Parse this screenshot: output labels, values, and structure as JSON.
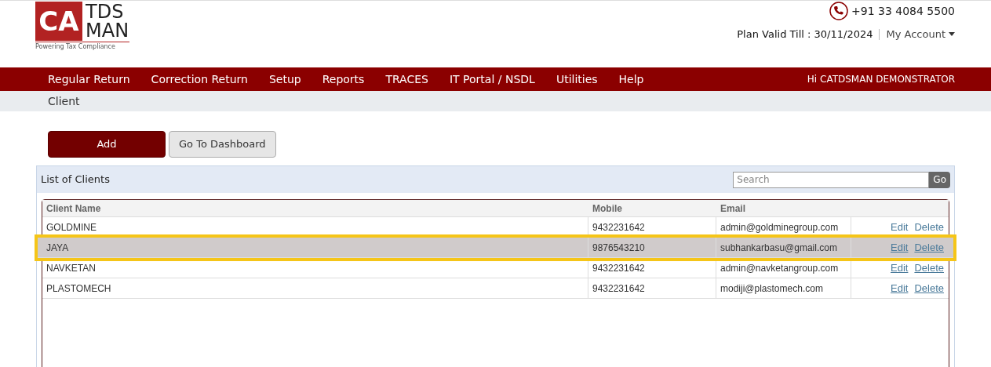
{
  "logo": {
    "mark": "CA",
    "line_1": "TDS",
    "line_2": "MAN",
    "tagline": "Powering Tax Compliance"
  },
  "phone": "+91 33 4084 5500",
  "plan_valid": "Plan Valid Till : 30/11/2024",
  "account_menu": "My Account",
  "nav": [
    "Regular Return",
    "Correction Return",
    "Setup",
    "Reports",
    "TRACES",
    "IT Portal / NSDL",
    "Utilities",
    "Help"
  ],
  "greeting": "Hi CATDSMAN DEMONSTRATOR",
  "breadcrumb": "Client",
  "buttons": [
    {
      "label": "Add",
      "kind": "primary"
    },
    {
      "label": "Go To Dashboard",
      "kind": "secondary"
    }
  ],
  "panel": {
    "title": "List of Clients",
    "search": {
      "placeholder": "Search"
    },
    "search_button": "Go"
  },
  "table": {
    "columns": [
      "Client Name",
      "Mobile",
      "Email"
    ],
    "rows": [
      {
        "name": "GOLDMINE",
        "mobile": "9432231642",
        "email": "admin@goldminegroup.com",
        "selected": false,
        "links_underlined": false,
        "actions": [
          "Edit",
          "Delete"
        ]
      },
      {
        "name": "JAYA",
        "mobile": "9876543210",
        "email": "subhankarbasu@gmail.com",
        "selected": true,
        "links_underlined": true,
        "actions": [
          "Edit",
          "Delete"
        ]
      },
      {
        "name": "NAVKETAN",
        "mobile": "9432231642",
        "email": "admin@navketangroup.com",
        "selected": false,
        "links_underlined": true,
        "actions": [
          "Edit",
          "Delete"
        ]
      },
      {
        "name": "PLASTOMECH",
        "mobile": "9432231642",
        "email": "modiji@plastomech.com",
        "selected": false,
        "links_underlined": true,
        "actions": [
          "Edit",
          "Delete"
        ]
      }
    ]
  }
}
